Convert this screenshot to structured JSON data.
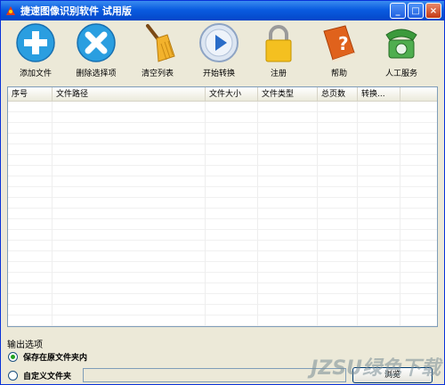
{
  "window": {
    "title": "捷速图像识别软件 试用版"
  },
  "title_buttons": {
    "minimize": "_",
    "maximize": "□",
    "close": "×"
  },
  "toolbar": {
    "items": [
      {
        "label": "添加文件",
        "icon": "plus-icon"
      },
      {
        "label": "删除选择项",
        "icon": "delete-icon"
      },
      {
        "label": "清空列表",
        "icon": "broom-icon"
      },
      {
        "label": "开始转换",
        "icon": "play-icon"
      },
      {
        "label": "注册",
        "icon": "lock-icon"
      },
      {
        "label": "帮助",
        "icon": "help-book-icon"
      },
      {
        "label": "人工服务",
        "icon": "phone-icon"
      }
    ]
  },
  "table": {
    "columns": [
      "序号",
      "文件路径",
      "文件大小",
      "文件类型",
      "总页数",
      "转换..."
    ]
  },
  "output": {
    "label": "输出选项",
    "option1": "保存在原文件夹内",
    "option2": "自定义文件夹",
    "path_value": "",
    "browse_label": "浏览"
  },
  "watermark": "JZSU绿色下载"
}
